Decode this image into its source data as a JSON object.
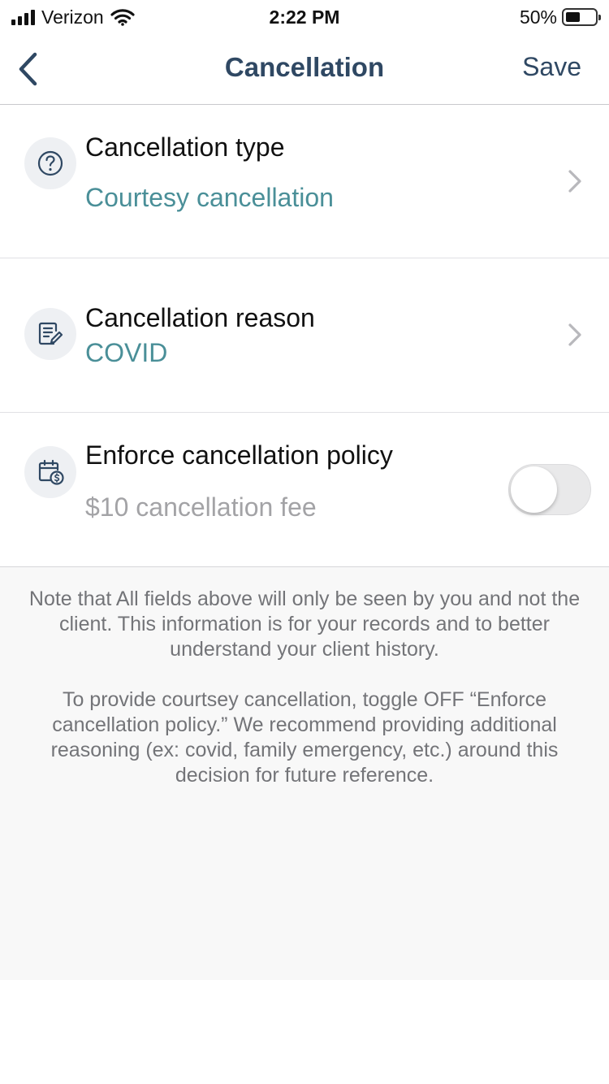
{
  "status_bar": {
    "carrier": "Verizon",
    "time": "2:22 PM",
    "battery": "50%",
    "battery_level": 0.5
  },
  "nav": {
    "title": "Cancellation",
    "save_label": "Save",
    "back_icon": "chevron-left-icon"
  },
  "rows": {
    "type": {
      "icon": "question-circle-icon",
      "label": "Cancellation type",
      "value": "Courtesy cancellation"
    },
    "reason": {
      "icon": "note-edit-icon",
      "label": "Cancellation reason",
      "value": "COVID"
    },
    "policy": {
      "icon": "calendar-dollar-icon",
      "label": "Enforce cancellation policy",
      "value": "$10 cancellation fee",
      "toggle_on": false
    }
  },
  "note": {
    "paragraph_1": "Note that All fields above will only be seen by you and not the client. This information is for your records and to better understand your client history.",
    "paragraph_2": "To provide courtsey cancellation, toggle OFF “Enforce cancellation policy.” We recommend providing additional reasoning (ex: covid, family emergency, etc.) around this decision for future reference."
  },
  "colors": {
    "nav_text": "#2f4863",
    "value_teal": "#4a8f98",
    "value_gray": "#a3a3a6",
    "note_background": "#f8f8f8"
  }
}
